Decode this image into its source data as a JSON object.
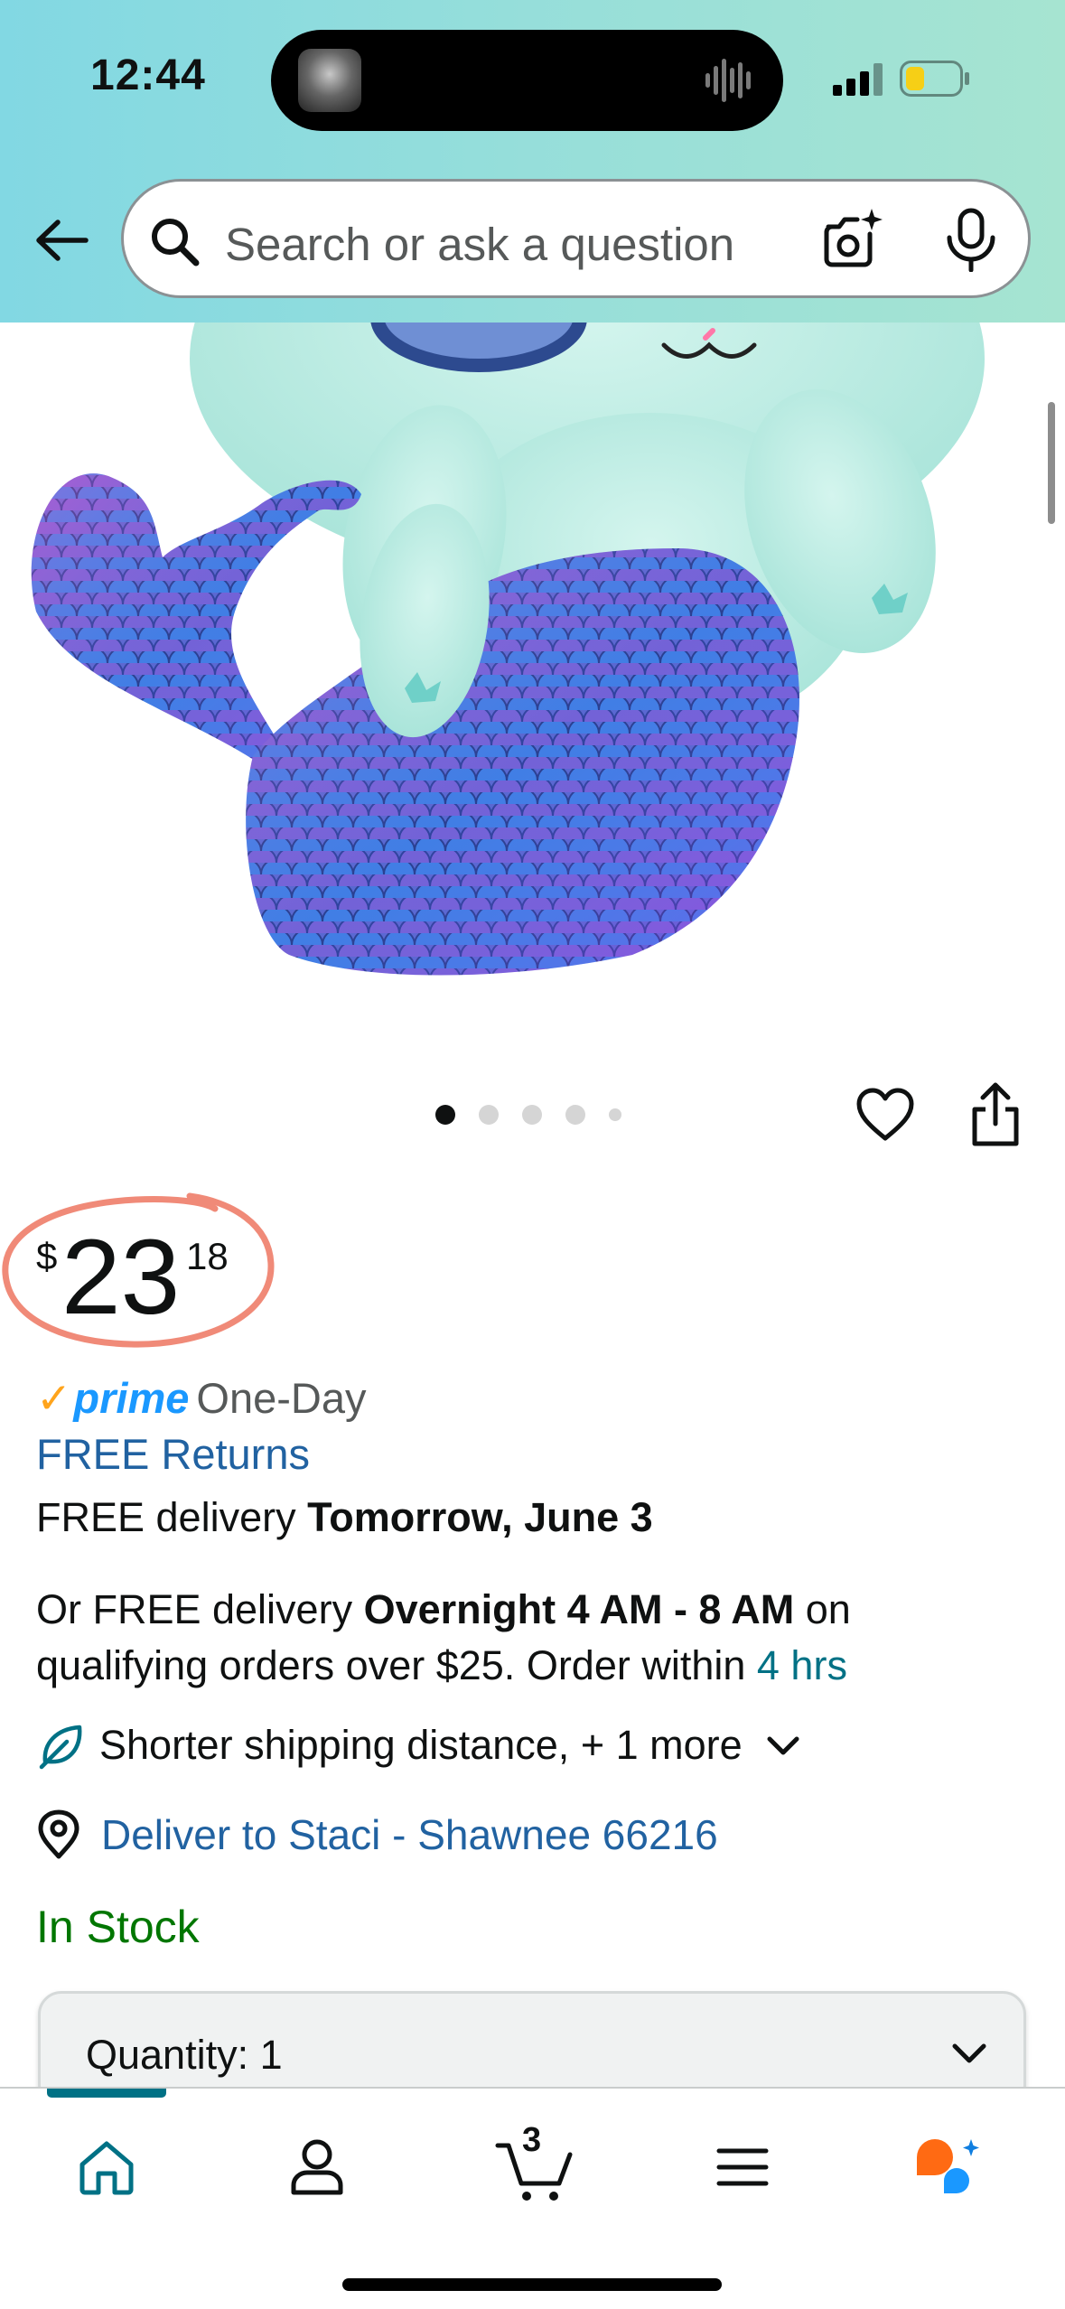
{
  "status_bar": {
    "time": "12:44"
  },
  "header": {
    "search": {
      "placeholder": "Search or ask a question"
    },
    "icons": [
      "back-arrow-icon",
      "search-icon",
      "camera-icon",
      "mic-icon"
    ]
  },
  "gallery": {
    "image_count": 5,
    "active_index": 0,
    "icons": [
      "heart-icon",
      "share-icon"
    ]
  },
  "price": {
    "symbol": "$",
    "whole": "23",
    "fraction": "18"
  },
  "prime": {
    "logo": "prime",
    "label": "One-Day"
  },
  "returns": {
    "label": "FREE Returns"
  },
  "delivery": {
    "prefix": "FREE delivery ",
    "date": "Tomorrow, June 3"
  },
  "overnight": {
    "prefix": "Or FREE delivery ",
    "window": "Overnight 4 AM - 8 AM",
    "middle": " on qualifying orders over $25. Order within ",
    "countdown": "4 hrs"
  },
  "sustainability": {
    "label": "Shorter shipping distance, + 1 more"
  },
  "deliver_to": {
    "label": "Deliver to Staci - Shawnee 66216"
  },
  "stock": {
    "status": "In Stock"
  },
  "quantity": {
    "label": "Quantity: ",
    "value": "1"
  },
  "bottom_nav": {
    "cart_count": "3",
    "items": [
      "home-icon",
      "account-icon",
      "cart-icon",
      "menu-icon",
      "rufus-assistant-icon"
    ],
    "active": "home-icon"
  },
  "colors": {
    "header_gradient_start": "#82d8e3",
    "header_gradient_end": "#a6e4d1",
    "link_blue": "#2162a1",
    "teal": "#007185",
    "in_stock_green": "#007600",
    "prime_blue": "#1a98ff",
    "prime_check_orange": "#ffa41c",
    "price_annotation": "#f08a78"
  }
}
